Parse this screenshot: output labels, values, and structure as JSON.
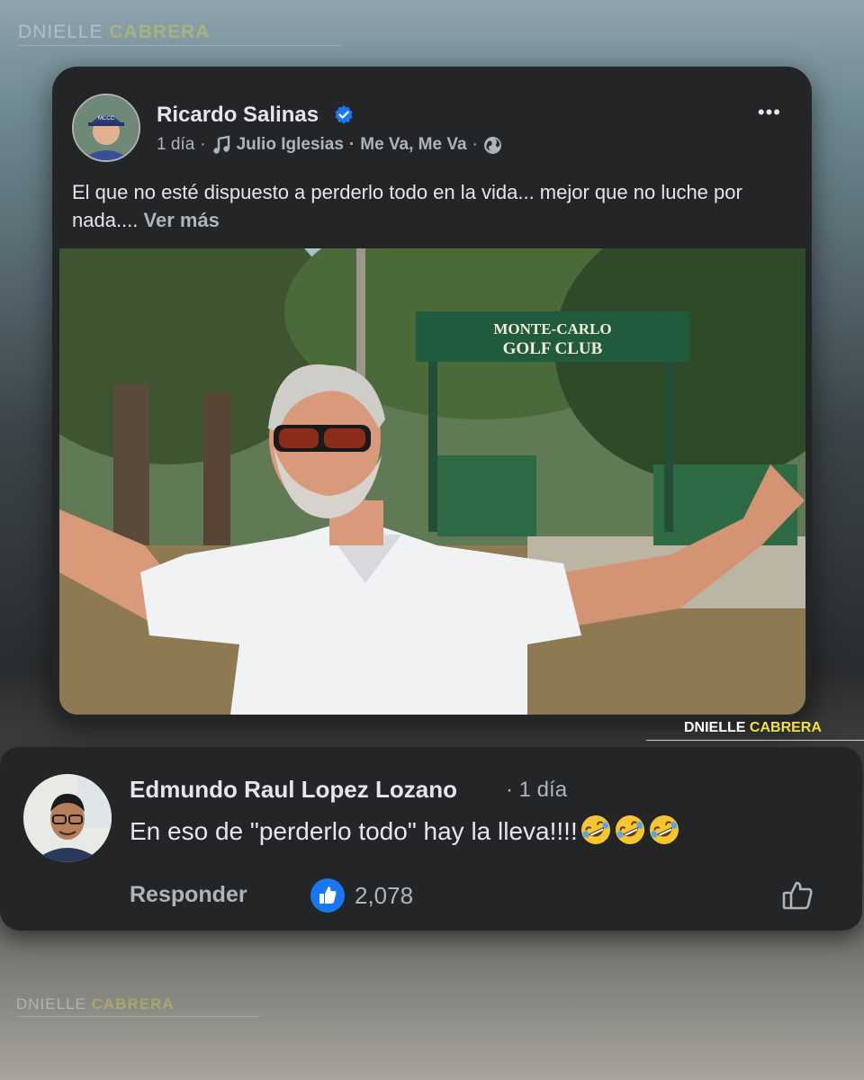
{
  "watermark": {
    "first": "DNIELLE",
    "last": "CABRERA"
  },
  "post": {
    "author": "Ricardo Salinas",
    "time": "1 día",
    "separator": "·",
    "song": "Julio Iglesias",
    "song_separator": "·",
    "song_title": "Me Va, Me Va",
    "more_menu": "•••",
    "text": "El que no esté dispuesto a perderlo todo en la vida... mejor que no luche por nada.... ",
    "see_more": "Ver más",
    "photo_sign_line1": "MONTE-CARLO",
    "photo_sign_line2": "GOLF CLUB"
  },
  "comment": {
    "author": "Edmundo Raul Lopez Lozano",
    "time": "· 1 día",
    "text": "En eso de \"perderlo todo\" hay la lleva!!!!",
    "reply_label": "Responder",
    "like_count": "2,078"
  },
  "colors": {
    "card_bg": "#242526",
    "primary_text": "#e4e6eb",
    "secondary_text": "#b0b3b8",
    "accent_blue": "#1877f2",
    "watermark_yellow": "#f2e23a"
  },
  "icons": [
    "verified-badge-icon",
    "music-note-icon",
    "globe-icon",
    "more-icon",
    "like-badge-icon",
    "like-outline-icon",
    "laughing-emoji-icon"
  ]
}
